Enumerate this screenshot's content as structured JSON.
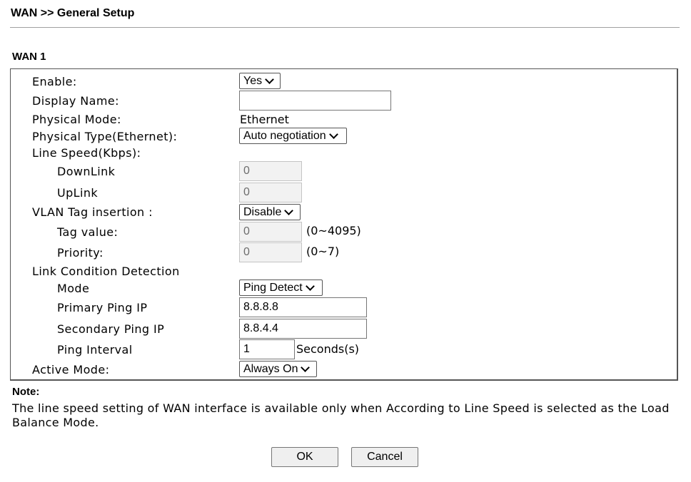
{
  "header": {
    "title": "WAN >> General Setup"
  },
  "section": {
    "title": "WAN 1"
  },
  "form": {
    "enable": {
      "label": "Enable:",
      "value": "Yes"
    },
    "display_name": {
      "label": "Display Name:",
      "value": ""
    },
    "physical_mode": {
      "label": "Physical Mode:",
      "value": "Ethernet"
    },
    "physical_type": {
      "label": "Physical Type(Ethernet):",
      "value": "Auto negotiation"
    },
    "line_speed": {
      "label": "Line Speed(Kbps):"
    },
    "downlink": {
      "label": "DownLink",
      "value": "0"
    },
    "uplink": {
      "label": "UpLink",
      "value": "0"
    },
    "vlan_tag": {
      "label": "VLAN Tag insertion :",
      "value": "Disable"
    },
    "tag_value": {
      "label": "Tag value:",
      "value": "0",
      "range": "(0~4095)"
    },
    "priority": {
      "label": "Priority:",
      "value": "0",
      "range": "(0~7)"
    },
    "link_condition": {
      "label": "Link Condition Detection"
    },
    "mode": {
      "label": "Mode",
      "value": "Ping Detect"
    },
    "primary_ping": {
      "label": "Primary Ping IP",
      "value": "8.8.8.8"
    },
    "secondary_ping": {
      "label": "Secondary Ping IP",
      "value": "8.8.4.4"
    },
    "ping_interval": {
      "label": "Ping Interval",
      "value": "1",
      "unit": "Seconds(s)"
    },
    "active_mode": {
      "label": "Active Mode:",
      "value": "Always On"
    }
  },
  "note": {
    "title": "Note:",
    "text": "The line speed setting of WAN interface is available only when According to Line Speed is selected as the Load Balance Mode."
  },
  "buttons": {
    "ok": "OK",
    "cancel": "Cancel"
  }
}
